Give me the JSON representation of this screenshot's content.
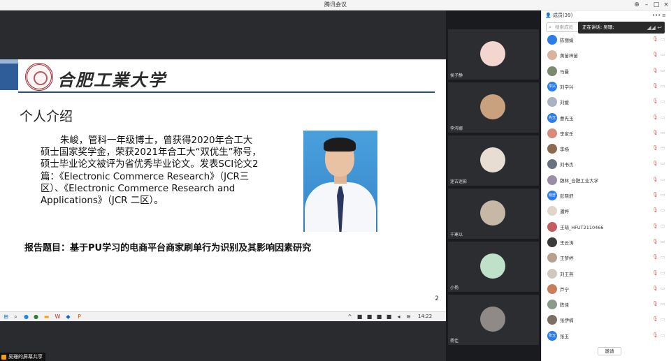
{
  "window": {
    "title": "腾讯会议"
  },
  "slide": {
    "logo_text": "合肥工業大学",
    "heading": "个人介绍",
    "intro": "朱峻，管科一年级博士，曾获得2020年合工大硕士国家奖学金，荣获2021年合工大“双优生”称号，硕士毕业论文被评为省优秀毕业论文。发表SCI论文2篇：《Electronic Commerce Research》（JCR三区）、《Electronic Commerce Research and Applications》（JCR 二区）。",
    "report": "报告题目：基于PU学习的电商平台商家刷单行为识别及其影响因素研究",
    "page_number": "2"
  },
  "taskbar": {
    "time": "14:22"
  },
  "share": {
    "label": "吴珊的屏幕共享"
  },
  "videos": [
    {
      "name": "侯子静",
      "color": "#f3d6cf"
    },
    {
      "name": "李涔娜",
      "color": "#c9a27d"
    },
    {
      "name": "迷古迷影",
      "color": "#e8ddd2"
    },
    {
      "name": "千寒以",
      "color": "#c7b7a6"
    },
    {
      "name": "小杨",
      "color": "#bfe0c9"
    },
    {
      "name": "杨佳",
      "color": "#8f8a88"
    }
  ],
  "panel": {
    "title": "成员(39)",
    "search_placeholder": "搜索成员",
    "speaking": "正在讲话: 吴珊;",
    "invite_label": "邀请",
    "members": [
      {
        "name": "陈丽娟",
        "avatar": "",
        "color": "#2b7de9"
      },
      {
        "name": "黄苗梓苗",
        "avatar": "",
        "color": "#d9b39a"
      },
      {
        "name": "马曼",
        "avatar": "",
        "color": "#7b8a6e"
      },
      {
        "name": "刘学兴",
        "avatar": "学兴",
        "color": "#2b7de9"
      },
      {
        "name": "刘媛",
        "avatar": "",
        "color": "#a9b3c2"
      },
      {
        "name": "曹先玉",
        "avatar": "先玉",
        "color": "#2b7de9"
      },
      {
        "name": "李家乐",
        "avatar": "",
        "color": "#d98a7c"
      },
      {
        "name": "李杨",
        "avatar": "",
        "color": "#8c6b4e"
      },
      {
        "name": "刘书杰",
        "avatar": "",
        "color": "#6a7280"
      },
      {
        "name": "魏林_合肥工业大学",
        "avatar": "",
        "color": "#9a8ea5"
      },
      {
        "name": "彭晓舒",
        "avatar": "晓舒",
        "color": "#2b7de9"
      },
      {
        "name": "潘婷",
        "avatar": "",
        "color": "#e0d6cc"
      },
      {
        "name": "王萌_HFUT2110466",
        "avatar": "",
        "color": "#c45d5d"
      },
      {
        "name": "王云涛",
        "avatar": "",
        "color": "#3a3a3a"
      },
      {
        "name": "王梦婷",
        "avatar": "",
        "color": "#b7a08c"
      },
      {
        "name": "刘王燕",
        "avatar": "",
        "color": "#cfc8be"
      },
      {
        "name": "芦宁",
        "avatar": "",
        "color": "#c97e5a"
      },
      {
        "name": "陈佳",
        "avatar": "",
        "color": "#8a9b8c"
      },
      {
        "name": "张伊楠",
        "avatar": "",
        "color": "#7d6f63"
      },
      {
        "name": "张玉",
        "avatar": "张玉",
        "color": "#2b7de9"
      }
    ]
  }
}
